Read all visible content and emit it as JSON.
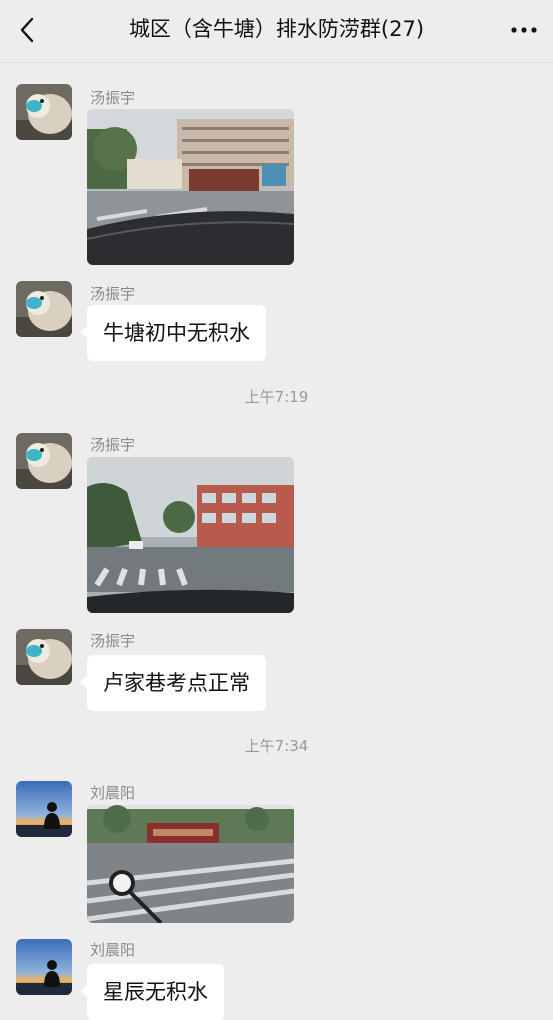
{
  "header": {
    "title": "城区（含牛塘）排水防涝群(27)",
    "back_icon": "chevron-left-icon",
    "more_icon": "more-horizontal-icon"
  },
  "messages": [
    {
      "type": "image",
      "sender": "汤振宇",
      "avatar": "tang-avatar",
      "image": "school-gate-rain-photo"
    },
    {
      "type": "text",
      "sender": "汤振宇",
      "avatar": "tang-avatar",
      "text": "牛塘初中无积水"
    },
    {
      "type": "time",
      "text": "上午7:19"
    },
    {
      "type": "image",
      "sender": "汤振宇",
      "avatar": "tang-avatar",
      "image": "street-crosswalk-rain-photo"
    },
    {
      "type": "text",
      "sender": "汤振宇",
      "avatar": "tang-avatar",
      "text": "卢家巷考点正常"
    },
    {
      "type": "time",
      "text": "上午7:34"
    },
    {
      "type": "image",
      "sender": "刘晨阳",
      "avatar": "liu-avatar",
      "image": "school-sign-road-photo"
    },
    {
      "type": "text",
      "sender": "刘晨阳",
      "avatar": "liu-avatar",
      "text": "星辰无积水"
    }
  ],
  "colors": {
    "background": "#ededed",
    "bubble": "#ffffff",
    "sender_name": "#8a8a8a",
    "timestamp": "#9a9a9a"
  }
}
